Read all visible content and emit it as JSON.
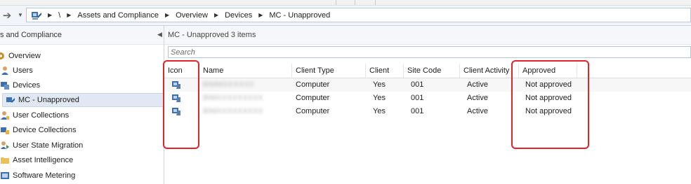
{
  "breadcrumb": {
    "root": "\\",
    "items": [
      "Assets and Compliance",
      "Overview",
      "Devices",
      "MC - Unapproved"
    ]
  },
  "nav": {
    "header": "s and Compliance",
    "items": [
      {
        "label": "Overview",
        "icon": "overview-icon"
      },
      {
        "label": "Users",
        "icon": "users-icon"
      },
      {
        "label": "Devices",
        "icon": "devices-icon"
      },
      {
        "label": "MC - Unapproved",
        "icon": "device-collection-icon",
        "selected": true
      },
      {
        "label": "User Collections",
        "icon": "user-collections-icon"
      },
      {
        "label": "Device Collections",
        "icon": "device-collections-icon"
      },
      {
        "label": "User State Migration",
        "icon": "user-state-migration-icon"
      },
      {
        "label": "Asset Intelligence",
        "icon": "folder-icon"
      },
      {
        "label": "Software Metering",
        "icon": "software-metering-icon"
      }
    ]
  },
  "content": {
    "title": "MC - Unapproved 3 items",
    "search_placeholder": "Search"
  },
  "table": {
    "columns": [
      "Icon",
      "Name",
      "Client Type",
      "Client",
      "Site Code",
      "Client Activity",
      "Approved"
    ],
    "rows": [
      {
        "name": "BIMMXXXXXX",
        "client_type": "Computer",
        "client": "Yes",
        "site_code": "001",
        "activity": "Active",
        "approved": "Not approved"
      },
      {
        "name": "BIMXXXXXXXXX",
        "client_type": "Computer",
        "client": "Yes",
        "site_code": "001",
        "activity": "Active",
        "approved": "Not approved"
      },
      {
        "name": "BIMXXXXXXXXX",
        "client_type": "Computer",
        "client": "Yes",
        "site_code": "001",
        "activity": "Active",
        "approved": "Not approved"
      }
    ]
  },
  "colors": {
    "callout": "#e0242c",
    "selection": "#dfe8f3"
  }
}
